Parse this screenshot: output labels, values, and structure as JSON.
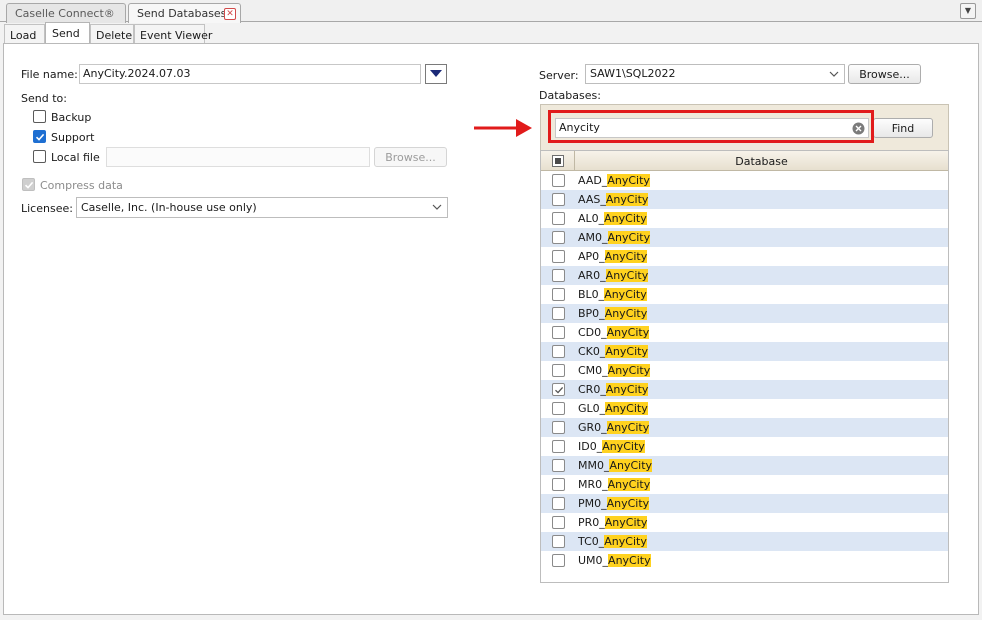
{
  "tabs": [
    {
      "label": "Caselle Connect®",
      "active": false
    },
    {
      "label": "Send Databases",
      "active": true,
      "close": "close-icon"
    }
  ],
  "subtabs": [
    {
      "label": "Load",
      "active": false
    },
    {
      "label": "Send",
      "active": true
    },
    {
      "label": "Delete",
      "active": false
    },
    {
      "label": "Event Viewer",
      "active": false
    }
  ],
  "left": {
    "file_name_label": "File name:",
    "file_name_value": "AnyCity.2024.07.03",
    "send_to_label": "Send to:",
    "backup_label": "Backup",
    "backup_checked": false,
    "support_label": "Support",
    "support_checked": true,
    "local_file_label": "Local file",
    "local_file_checked": false,
    "local_file_value": "",
    "browse_label": "Browse...",
    "compress_label": "Compress data",
    "compress_checked": true,
    "compress_enabled": false,
    "licensee_label": "Licensee:",
    "licensee_value": "Caselle, Inc. (In-house use only)"
  },
  "right": {
    "server_label": "Server:",
    "server_value": "SAW1\\SQL2022",
    "browse_label": "Browse...",
    "databases_label": "Databases:",
    "search_value": "Anycity",
    "find_label": "Find",
    "column_header": "Database",
    "highlight_text": "AnyCity",
    "rows": [
      {
        "prefix": "AAD_",
        "match": "AnyCity",
        "checked": false
      },
      {
        "prefix": "AAS_",
        "match": "AnyCity",
        "checked": false
      },
      {
        "prefix": "AL0_",
        "match": "AnyCity",
        "checked": false
      },
      {
        "prefix": "AM0_",
        "match": "AnyCity",
        "checked": false
      },
      {
        "prefix": "AP0_",
        "match": "AnyCity",
        "checked": false
      },
      {
        "prefix": "AR0_",
        "match": "AnyCity",
        "checked": false
      },
      {
        "prefix": "BL0_",
        "match": "AnyCity",
        "checked": false
      },
      {
        "prefix": "BP0_",
        "match": "AnyCity",
        "checked": false
      },
      {
        "prefix": "CD0_",
        "match": "AnyCity",
        "checked": false
      },
      {
        "prefix": "CK0_",
        "match": "AnyCity",
        "checked": false
      },
      {
        "prefix": "CM0_",
        "match": "AnyCity",
        "checked": false
      },
      {
        "prefix": "CR0_",
        "match": "AnyCity",
        "checked": true
      },
      {
        "prefix": "GL0_",
        "match": "AnyCity",
        "checked": false
      },
      {
        "prefix": "GR0_",
        "match": "AnyCity",
        "checked": false
      },
      {
        "prefix": "ID0_",
        "match": "AnyCity",
        "checked": false
      },
      {
        "prefix": "MM0_",
        "match": "AnyCity",
        "checked": false
      },
      {
        "prefix": "MR0_",
        "match": "AnyCity",
        "checked": false
      },
      {
        "prefix": "PM0_",
        "match": "AnyCity",
        "checked": false
      },
      {
        "prefix": "PR0_",
        "match": "AnyCity",
        "checked": false
      },
      {
        "prefix": "TC0_",
        "match": "AnyCity",
        "checked": false
      },
      {
        "prefix": "UM0_",
        "match": "AnyCity",
        "checked": false
      }
    ]
  },
  "colors": {
    "annotation_red": "#e11b1b",
    "checkbox_blue": "#1e6fd2",
    "row_alt": "#dce6f4",
    "match_highlight": "#ffd21f"
  }
}
